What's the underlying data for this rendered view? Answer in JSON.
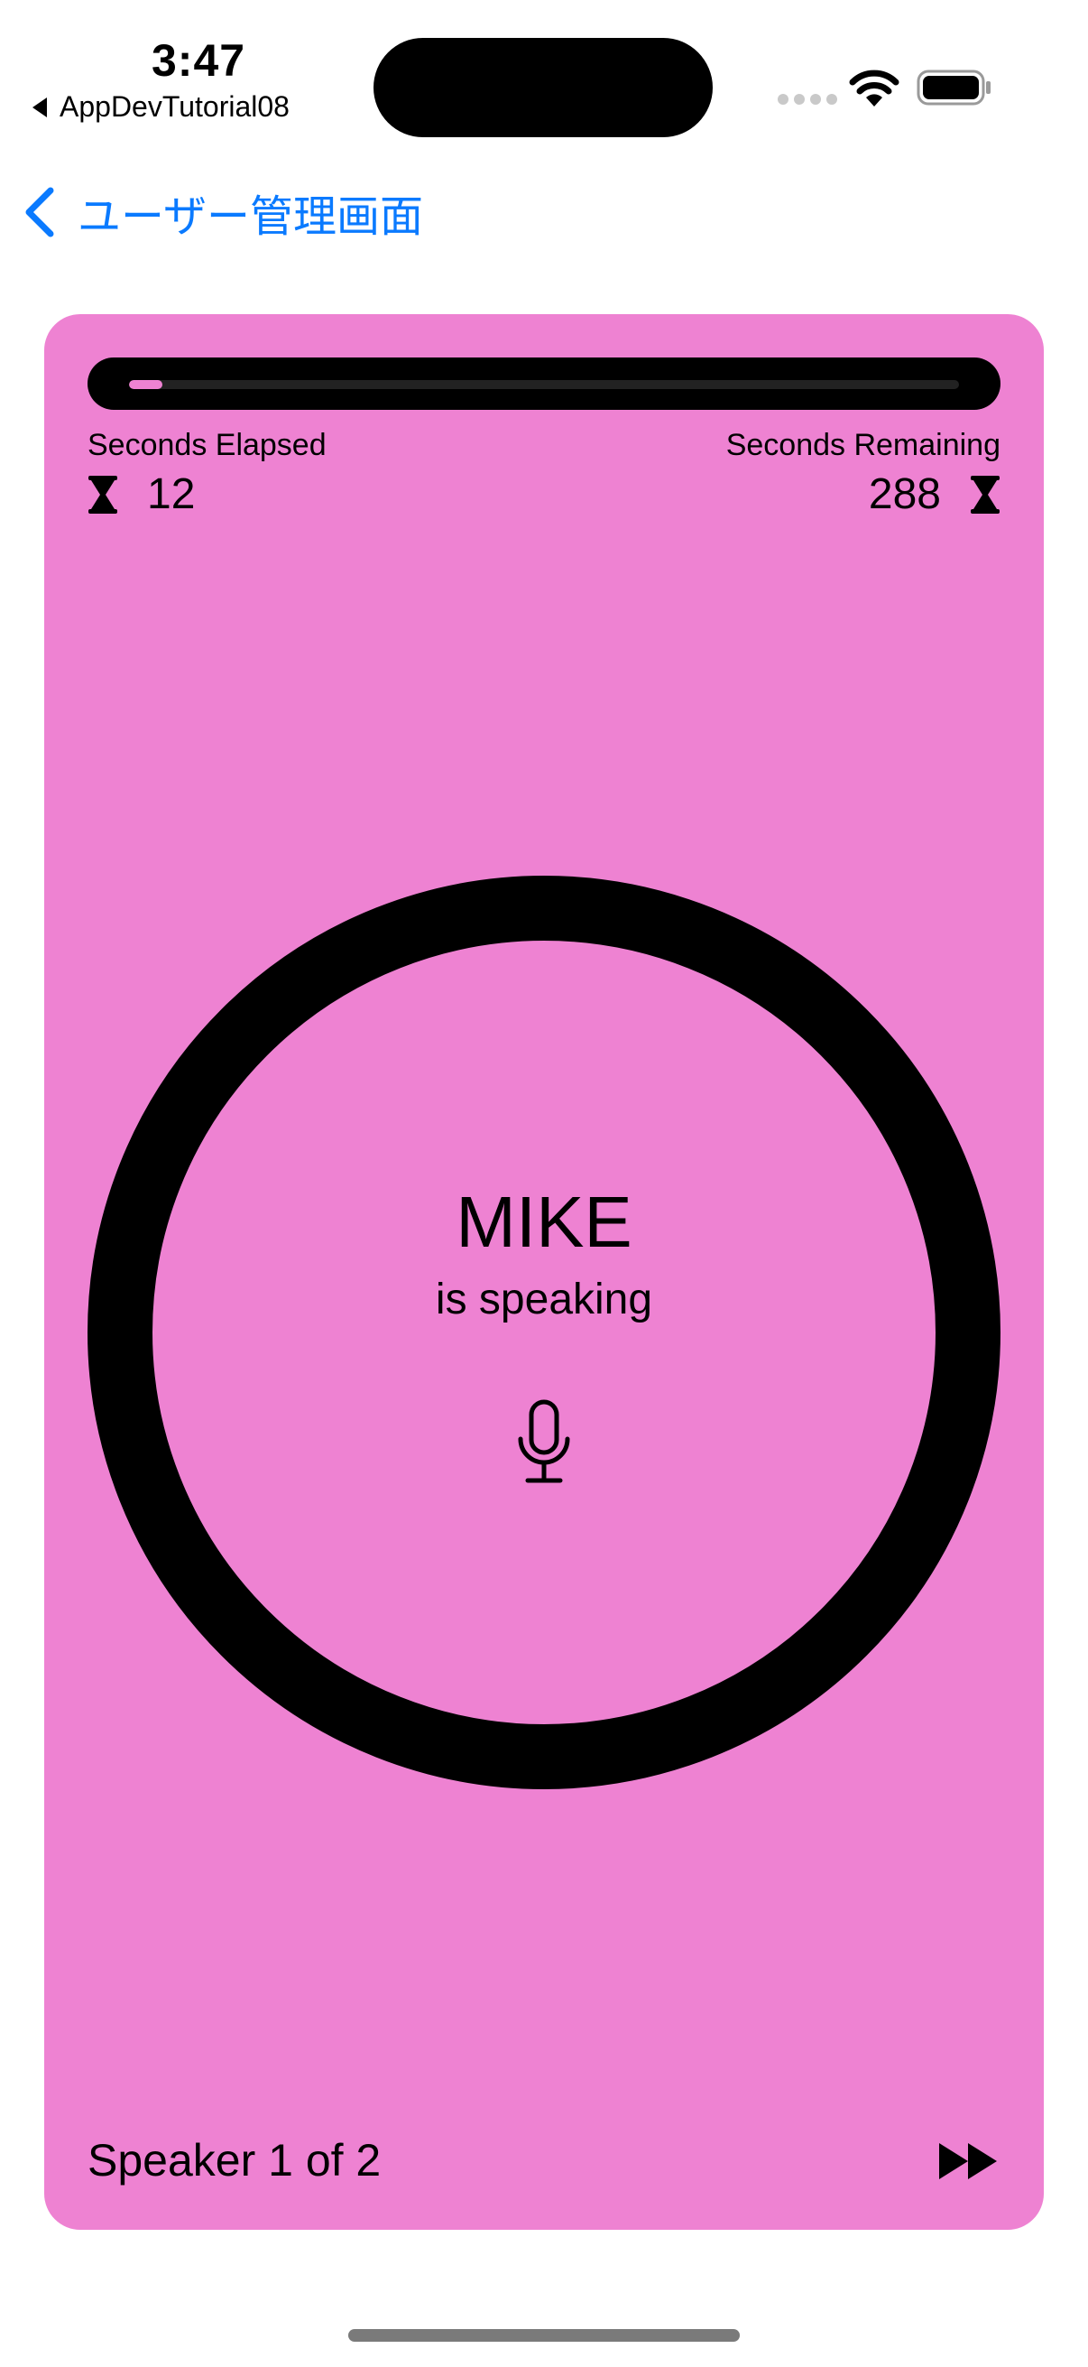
{
  "status_bar": {
    "time": "3:47",
    "back_app_label": "AppDevTutorial08"
  },
  "nav": {
    "back_label": "ユーザー管理画面"
  },
  "meeting": {
    "accent_color": "#ee82d2",
    "progress_fraction": 0.04,
    "seconds_elapsed_label": "Seconds Elapsed",
    "seconds_elapsed": "12",
    "seconds_remaining_label": "Seconds Remaining",
    "seconds_remaining": "288",
    "speaker_name": "MIKE",
    "speaker_status": "is speaking",
    "speaker_count": "Speaker 1 of 2"
  },
  "icons": {
    "timer": "hourglass-icon",
    "mic": "mic-icon",
    "skip": "forward-icon",
    "back": "chevron-left-icon"
  }
}
